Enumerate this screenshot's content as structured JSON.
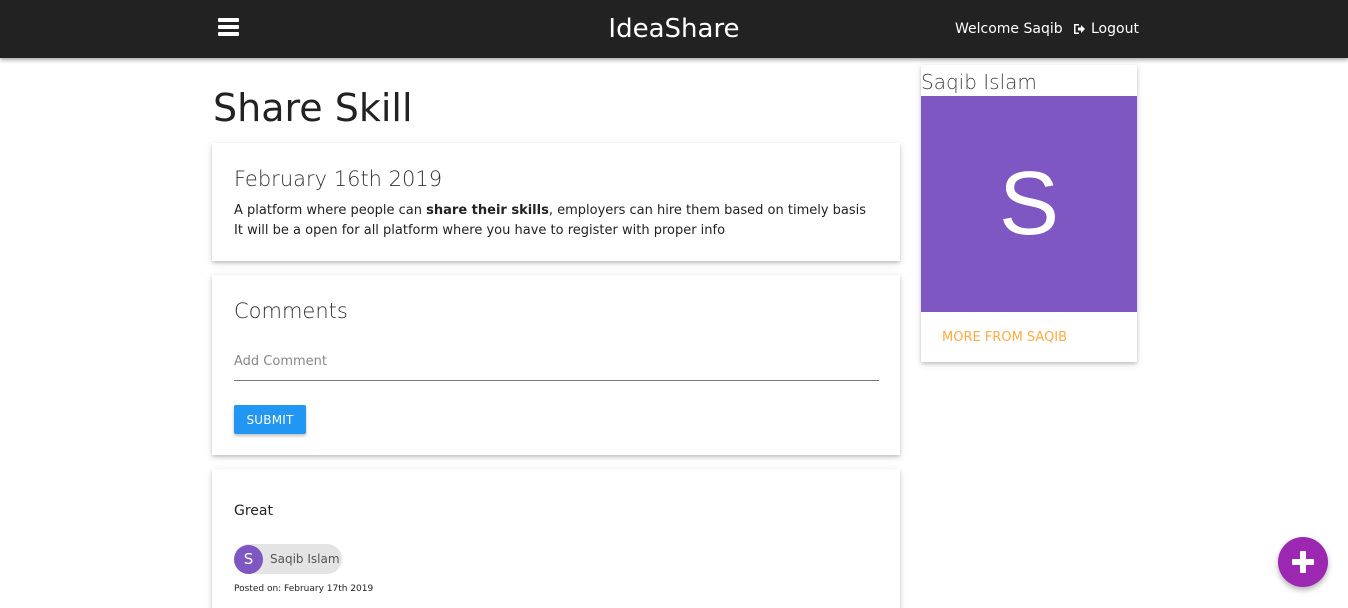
{
  "nav": {
    "brand": "IdeaShare",
    "welcome": "Welcome Saqib",
    "logout_label": "Logout",
    "menu_icon": "hamburger-menu-icon",
    "logout_icon": "sign-out-icon"
  },
  "page": {
    "title": "Share Skill"
  },
  "idea": {
    "date": "February 16th 2019",
    "line1_before": "A platform where people can ",
    "line1_bold": "share their skills",
    "line1_after": ", employers can hire them based on timely basis",
    "line2": "It will be a open for all platform where you have to register with proper info"
  },
  "comments": {
    "title": "Comments",
    "input_placeholder": "Add Comment",
    "input_value": "",
    "submit_label": "SUBMIT"
  },
  "comment_list": [
    {
      "body": "Great",
      "author_initial": "S",
      "author_name": "Saqib Islam",
      "posted": "Posted on: February 17th 2019"
    }
  ],
  "profile": {
    "name": "Saqib Islam",
    "initial": "S",
    "more_link": "MORE FROM SAQIB"
  },
  "colors": {
    "navbar": "#222222",
    "submit": "#2196f3",
    "avatar": "#7e57c2",
    "link_accent": "#ffab40",
    "fab": "#9c27b0"
  },
  "fab": {
    "icon": "plus-icon"
  }
}
